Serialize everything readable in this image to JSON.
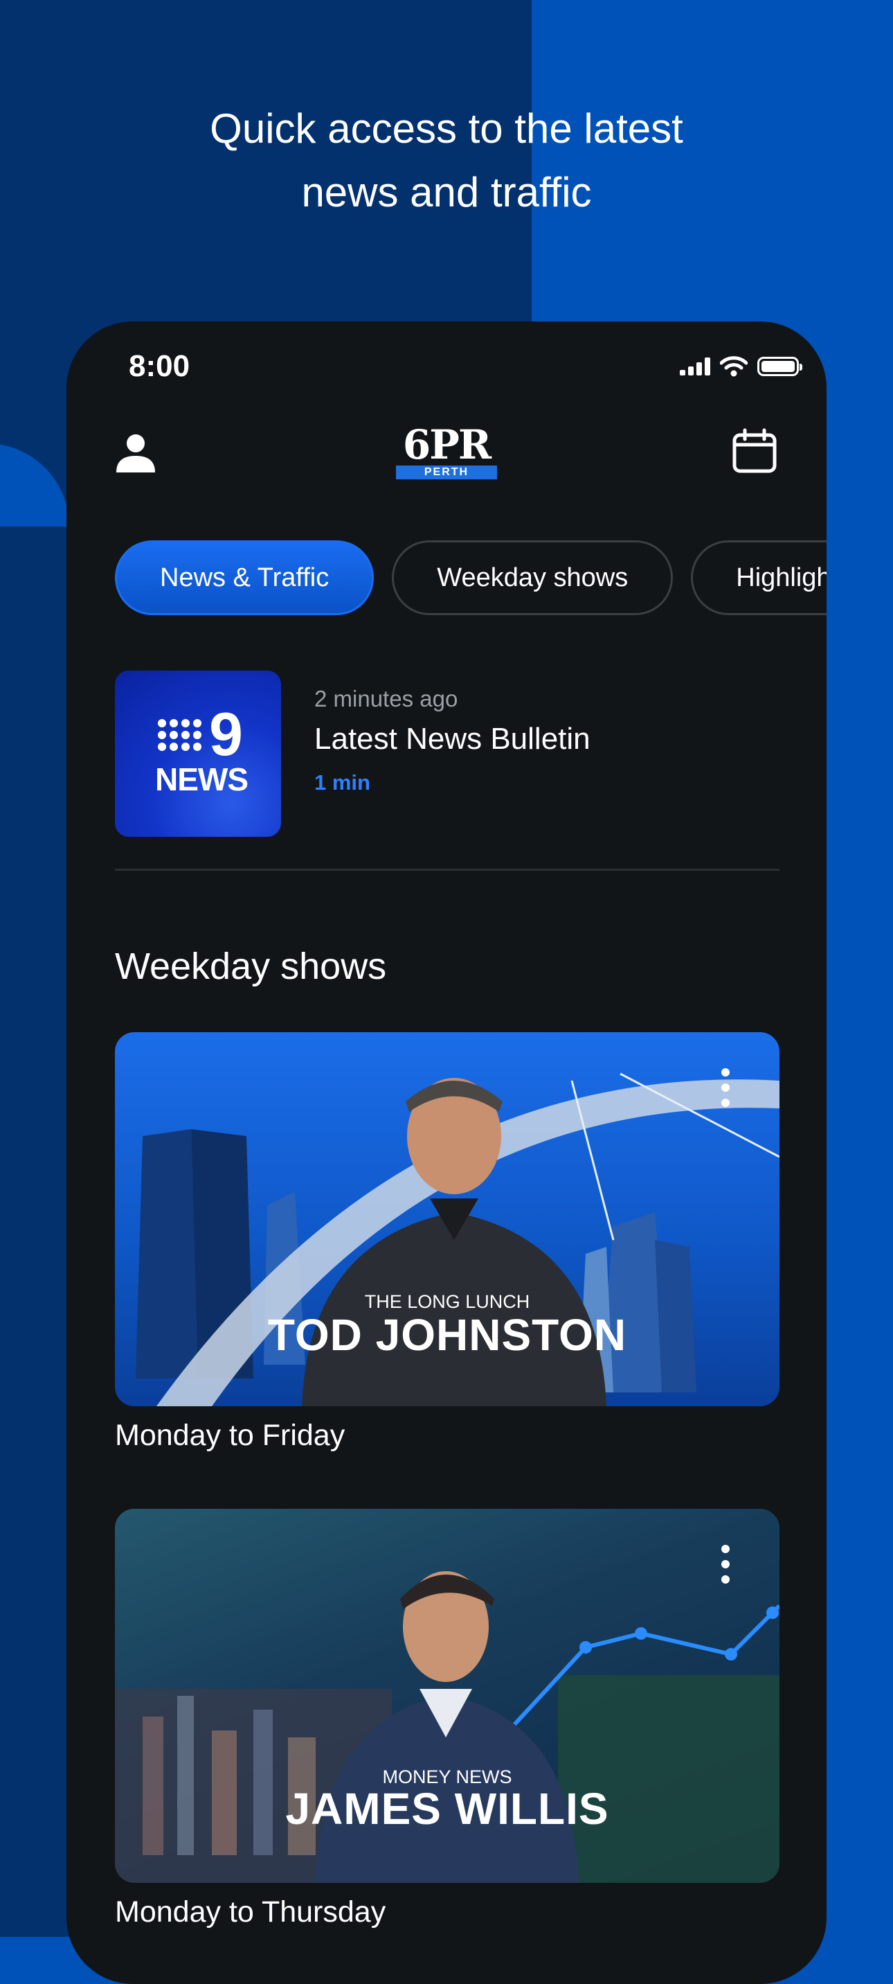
{
  "headline": {
    "line1": "Quick access to the latest",
    "line2": "news and traffic"
  },
  "status_bar": {
    "time": "8:00"
  },
  "header": {
    "logo_text": "6PR",
    "logo_sub": "PERTH",
    "profile_icon": "person-icon",
    "calendar_icon": "calendar-icon"
  },
  "tabs": [
    {
      "label": "News & Traffic",
      "active": true
    },
    {
      "label": "Weekday shows",
      "active": false
    },
    {
      "label": "Highlights",
      "active": false
    }
  ],
  "bulletin": {
    "brand_number": "9",
    "brand_word": "NEWS",
    "time_ago": "2 minutes ago",
    "title": "Latest News Bulletin",
    "duration": "1 min"
  },
  "weekday_section": {
    "title": "Weekday shows",
    "shows": [
      {
        "kicker": "THE LONG LUNCH",
        "host": "TOD JOHNSTON",
        "schedule": "Monday to Friday"
      },
      {
        "kicker": "MONEY NEWS",
        "host": "JAMES WILLIS",
        "schedule": "Monday to Thursday"
      }
    ]
  },
  "colors": {
    "accent": "#1a6df0",
    "background_dark": "#111518",
    "brand_blue": "#0052b8"
  }
}
